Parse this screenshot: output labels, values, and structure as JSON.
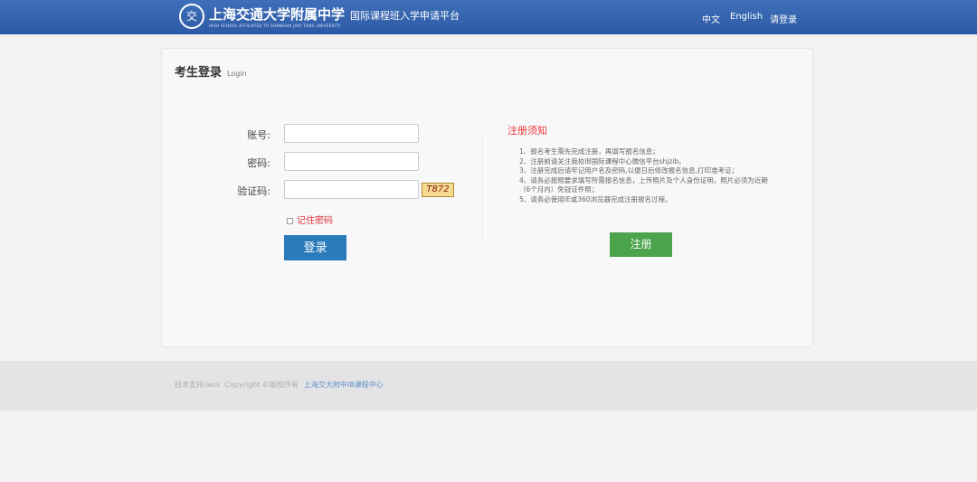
{
  "header": {
    "logo_text": "交",
    "brand": "上海交通大学附属中学",
    "subtitle": "国际课程班入学申请平台",
    "brand_en": "HIGH SCHOOL AFFILIATED TO SHANGHAI JIAO TONG UNIVERSITY",
    "nav": [
      "中文",
      "English",
      "请登录"
    ]
  },
  "login": {
    "title": "考生登录",
    "title_en": "Login",
    "account_label": "账号:",
    "password_label": "密码:",
    "captcha_label": "验证码:",
    "captcha_text": "T872",
    "remember": "记住密码",
    "submit": "登录"
  },
  "notice": {
    "title": "注册须知",
    "items": [
      "1、报名考生需先完成注册，再填写报名信息；",
      "2、注册前请关注我校IB国际课程中心微信平台shjzib。",
      "3、注册完成后请牢记用户名及密码,以便日后修改报名信息,打印准考证；",
      "4、请务必按照要求填写所需报名信息，上传照片及个人身份证明，照片必须为近期（6个月内）免冠证件照；",
      "5、请务必使用IE或360浏览器完成注册报名过程。"
    ],
    "register": "注册"
  },
  "footer": {
    "support": "技术支持:less",
    "copyright": "Copyright ©版权所有",
    "link": "上海交大附中IB课程中心"
  }
}
